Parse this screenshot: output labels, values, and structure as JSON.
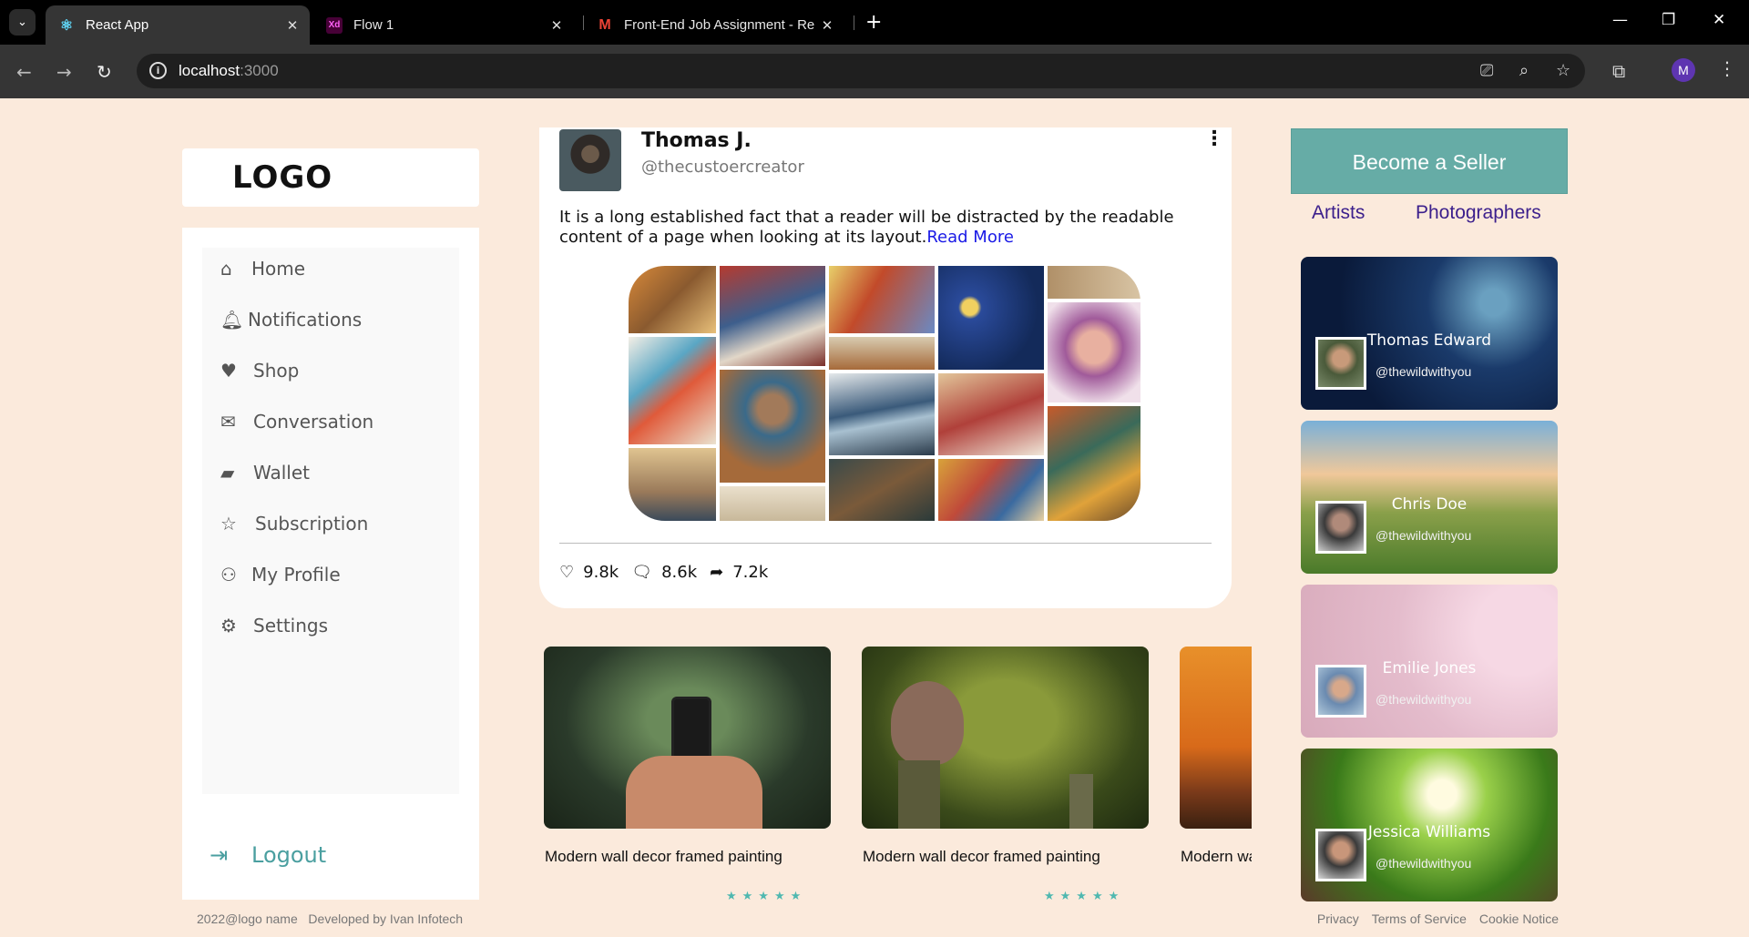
{
  "browser": {
    "tabs": [
      {
        "title": "React App",
        "active": true
      },
      {
        "title": "Flow 1",
        "active": false
      },
      {
        "title": "Front-End Job Assignment - Re",
        "active": false
      }
    ],
    "url_host": "localhost",
    "url_port": ":3000",
    "profile_initial": "M"
  },
  "logo": "LOGO",
  "nav": {
    "items": [
      {
        "label": "Home",
        "icon": "home-icon"
      },
      {
        "label": "Notifications",
        "icon": "bell-icon"
      },
      {
        "label": "Shop",
        "icon": "heart-icon"
      },
      {
        "label": "Conversation",
        "icon": "envelope-icon"
      },
      {
        "label": "Wallet",
        "icon": "wallet-icon"
      },
      {
        "label": "Subscription",
        "icon": "star-icon"
      },
      {
        "label": "My Profile",
        "icon": "user-icon"
      },
      {
        "label": "Settings",
        "icon": "gear-icon"
      }
    ],
    "logout": "Logout"
  },
  "post": {
    "name": "Thomas J.",
    "handle": "@thecustoercreator",
    "text": "It is a long established fact that a reader will be distracted by the readable content of a page when looking at its layout.",
    "read_more": "Read More",
    "likes": "9.8k",
    "comments": "8.6k",
    "shares": "7.2k"
  },
  "products": [
    {
      "title": "Modern wall decor framed painting"
    },
    {
      "title": "Modern wall decor framed painting"
    },
    {
      "title": "Modern wall decor framed painting"
    }
  ],
  "right": {
    "seller_button": "Become a Seller",
    "links": [
      "Artists",
      "Photographers"
    ],
    "profiles": [
      {
        "name": "Thomas Edward",
        "handle": "@thewildwithyou"
      },
      {
        "name": "Chris Doe",
        "handle": "@thewildwithyou"
      },
      {
        "name": "Emilie Jones",
        "handle": "@thewildwithyou"
      },
      {
        "name": "Jessica Williams",
        "handle": "@thewildwithyou"
      }
    ]
  },
  "footer": {
    "copyright": "2022@logo name",
    "developer": "Developed by Ivan Infotech",
    "links": [
      "Privacy",
      "Terms of Service",
      "Cookie Notice"
    ]
  },
  "colors": {
    "page_bg": "#fbeadc",
    "accent_teal": "#66aca6",
    "read_more": "#1a1ae6",
    "link_purple": "#3b1f8c"
  }
}
